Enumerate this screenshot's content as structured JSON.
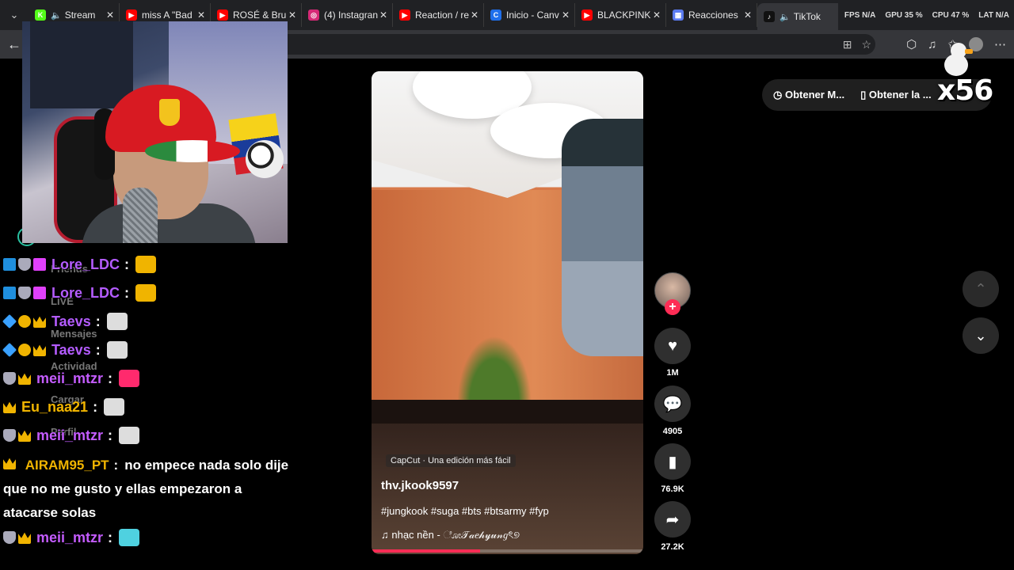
{
  "tabs": [
    {
      "label": "Stream",
      "favicon_color": "#53fc18",
      "favicon_char": "K",
      "audio": true
    },
    {
      "label": "miss A \"Bad",
      "favicon_color": "#ff0000",
      "favicon_char": "▶"
    },
    {
      "label": "ROSÉ & Bru",
      "favicon_color": "#ff0000",
      "favicon_char": "▶"
    },
    {
      "label": "(4) Instagran",
      "favicon_color": "#d62976",
      "favicon_char": "◎"
    },
    {
      "label": "Reaction / re",
      "favicon_color": "#ff0000",
      "favicon_char": "▶"
    },
    {
      "label": "Inicio - Canv",
      "favicon_color": "#1f6feb",
      "favicon_char": "C"
    },
    {
      "label": "BLACKPINK",
      "favicon_color": "#ff0000",
      "favicon_char": "▶"
    },
    {
      "label": "Reacciones",
      "favicon_color": "#5b7bf0",
      "favicon_char": "▦"
    },
    {
      "label": "TikTok",
      "favicon_color": "#111111",
      "favicon_char": "♪",
      "audio": true,
      "active": true
    }
  ],
  "perf": {
    "fps": "FPS N/A",
    "gpu": "GPU 35 %",
    "cpu": "CPU 47 %",
    "lat": "LAT N/A"
  },
  "toolbar": {
    "back": "←",
    "icons": [
      "⊞",
      "☆",
      "⬡",
      "♫",
      "✩",
      "⋯"
    ]
  },
  "chat": {
    "lines": [
      {
        "user": "Lore_LDC",
        "color": "#b45cff",
        "sep": ":",
        "emote_color": "#f0b400"
      },
      {
        "user": "Lore_LDC",
        "color": "#b45cff",
        "sep": ":",
        "emote_color": "#f0b400"
      },
      {
        "user": "Taevs",
        "color": "#b45cff",
        "sep": ":",
        "emote_color": "#dddddd"
      },
      {
        "user": "Taevs",
        "color": "#b45cff",
        "sep": ":",
        "emote_color": "#dddddd"
      },
      {
        "user": "meii_mtzr",
        "color": "#c45cff",
        "sep": ":",
        "emote_color": "#ff2a6d"
      },
      {
        "user": "Eu_naa21",
        "color": "#f0b400",
        "sep": ":",
        "emote_color": "#dddddd"
      },
      {
        "user": "meii_mtzr",
        "color": "#c45cff",
        "sep": ":",
        "emote_color": "#dddddd"
      }
    ],
    "long_user": "AIRAM95_PT",
    "long_user_color": "#f0b400",
    "long_message": "no empece nada solo dije que no me gusto y ellas empezaron a atacarse solas",
    "last_user": "meii_mtzr",
    "last_user_color": "#c45cff",
    "ghost_nav": [
      "Friends",
      "LIVE",
      "Mensajes",
      "Actividad",
      "Cargar",
      "Perfil"
    ]
  },
  "video": {
    "capcut": "CapCut · Una edición más fácil",
    "author": "thv.jkook9597",
    "tags": "#jungkook #suga #bts #btsarmy #fyp",
    "music": "♫  nhạc nền - ೋ𝒯𝒶𝑒𝒽𝓎𝓊𝓃𝑔ৎ୭",
    "progress": 0.4
  },
  "actions": {
    "likes": "1M",
    "comments": "4905",
    "saves": "76.9K",
    "shares": "27.2K",
    "follow": "+"
  },
  "right": {
    "get_btn_1": "Obtener M...",
    "get_btn_2": "Obtener la ...",
    "counter": "x56",
    "up": "⌃",
    "down": "⌄"
  }
}
